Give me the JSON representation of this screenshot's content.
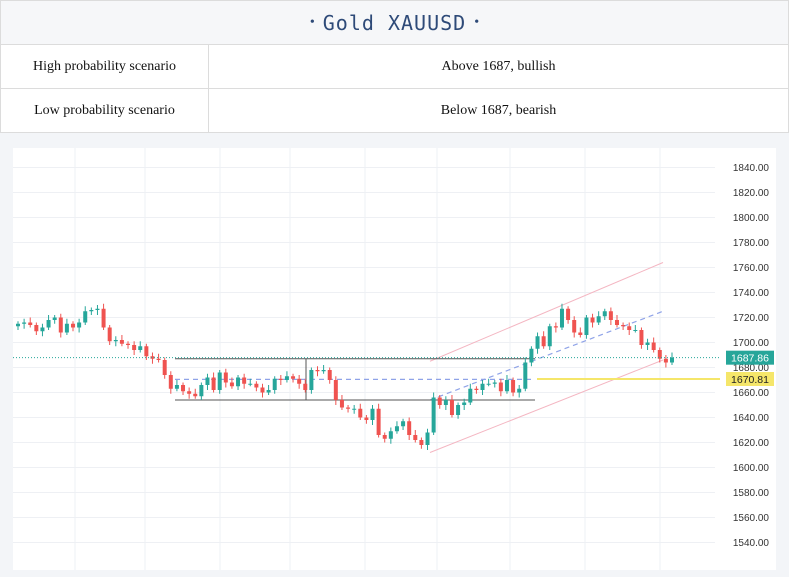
{
  "header": {
    "title": "Gold XAUUSD",
    "bullet": "•"
  },
  "scenarios": [
    {
      "label": "High probability scenario",
      "value": "Above 1687, bullish"
    },
    {
      "label": "Low probability scenario",
      "value": "Below 1687, bearish"
    }
  ],
  "colors": {
    "title": "#2e4a78",
    "bull": "#26a69a",
    "bear": "#ef5350",
    "channel": "#f4b6c2",
    "dashed": "#8fa3e8",
    "range_line": "#555555",
    "last_price_bg": "#26a69a",
    "level_line": "#f5e66a",
    "level_label_bg": "#f5e66a"
  },
  "chart_data": {
    "type": "candlestick",
    "symbol": "XAUUSD",
    "y_ticks": [
      "1840.00",
      "1820.00",
      "1800.00",
      "1780.00",
      "1760.00",
      "1740.00",
      "1720.00",
      "1700.00",
      "1680.00",
      "1660.00",
      "1640.00",
      "1620.00",
      "1600.00",
      "1580.00",
      "1560.00",
      "1540.00"
    ],
    "ylim": [
      1532,
      1850
    ],
    "last_price": 1687.86,
    "last_price_label": "1687.86",
    "level": 1670.81,
    "level_label": "1670.81",
    "grid": true,
    "closes": [
      1715,
      1716,
      1714,
      1709,
      1712,
      1718,
      1720,
      1708,
      1715,
      1712,
      1716,
      1725,
      1726,
      1727,
      1712,
      1701,
      1702,
      1699,
      1698,
      1694,
      1697,
      1689,
      1687,
      1686,
      1674,
      1663,
      1666,
      1661,
      1659,
      1657,
      1666,
      1672,
      1662,
      1676,
      1668,
      1665,
      1672,
      1667,
      1667,
      1664,
      1660,
      1662,
      1671,
      1670,
      1673,
      1671,
      1667,
      1662,
      1678,
      1677,
      1678,
      1670,
      1654,
      1648,
      1647,
      1647,
      1640,
      1638,
      1647,
      1626,
      1623,
      1629,
      1633,
      1637,
      1626,
      1622,
      1618,
      1628,
      1656,
      1650,
      1654,
      1642,
      1650,
      1652,
      1663,
      1662,
      1667,
      1667,
      1668,
      1661,
      1670,
      1660,
      1663,
      1684,
      1695,
      1705,
      1697,
      1713,
      1712,
      1727,
      1718,
      1708,
      1706,
      1720,
      1716,
      1721,
      1725,
      1718,
      1714,
      1713,
      1710,
      1710,
      1698,
      1700,
      1694,
      1687,
      1684,
      1688
    ]
  }
}
